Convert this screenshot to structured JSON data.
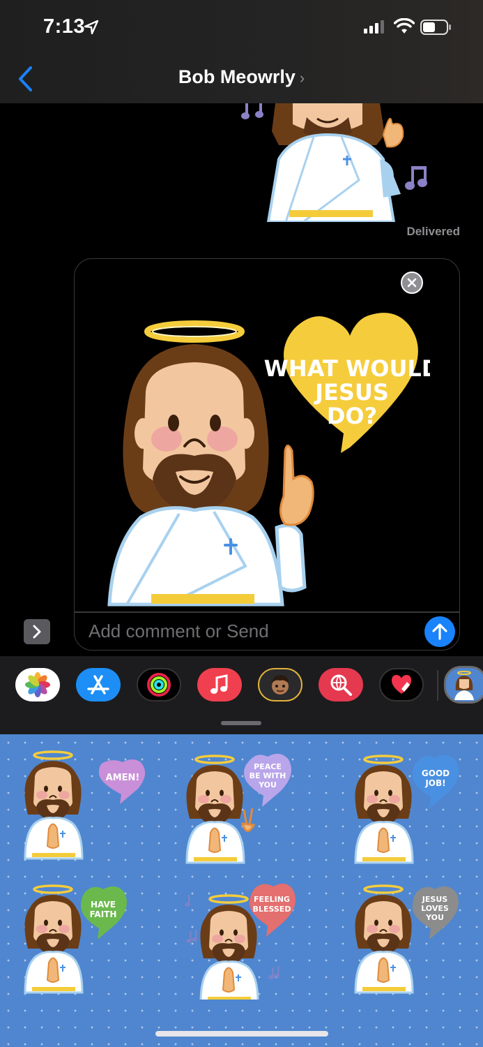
{
  "status_bar": {
    "time": "7:13"
  },
  "nav": {
    "contact_name": "Bob Meowrly",
    "chevron": "›"
  },
  "conversation": {
    "delivered_label": "Delivered"
  },
  "compose": {
    "placeholder": "Add comment or Send",
    "sticker_caption": [
      "WHAT WOULD",
      "JESUS",
      "DO?"
    ]
  },
  "app_drawer": {
    "apps": [
      "photos-icon",
      "app-store-icon",
      "activity-icon",
      "music-icon",
      "memoji-icon",
      "web-search-icon",
      "digital-touch-icon",
      "jesus-stickers-icon"
    ]
  },
  "stickers": [
    {
      "caption": [
        "AMEN!"
      ],
      "bubble_color": "#c98fd8",
      "pose": "praying"
    },
    {
      "caption": [
        "PEACE",
        "BE WITH",
        "YOU"
      ],
      "bubble_color": "#b9a5ea",
      "pose": "peace"
    },
    {
      "caption": [
        "GOOD",
        "JOB!"
      ],
      "bubble_color": "#4a90e2",
      "pose": "clapping"
    },
    {
      "caption": [
        "HAVE",
        "FAITH"
      ],
      "bubble_color": "#6bb94d",
      "pose": "praying"
    },
    {
      "caption": [
        "FEELING",
        "BLESSED"
      ],
      "bubble_color": "#e36f6f",
      "pose": "singing"
    },
    {
      "caption": [
        "JESUS",
        "LOVES",
        "YOU"
      ],
      "bubble_color": "#8c8c8c",
      "pose": "praying"
    }
  ]
}
